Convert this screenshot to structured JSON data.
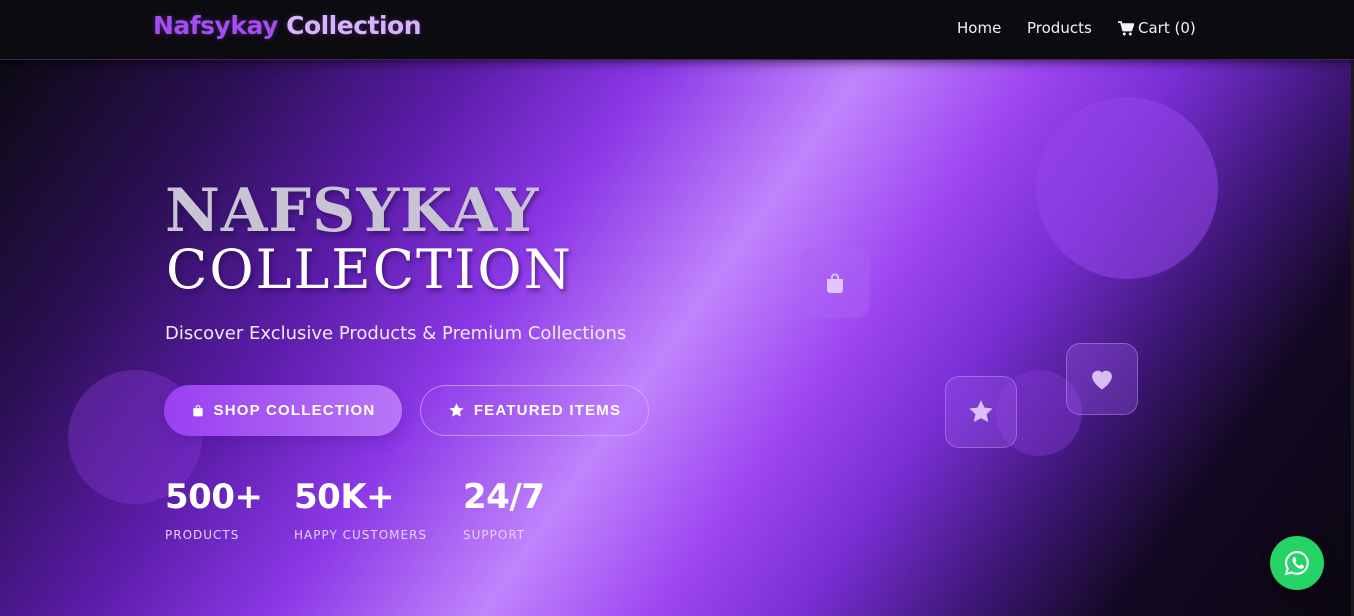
{
  "nav": {
    "brand_part1": "Nafsykay",
    "brand_part2": "Collection",
    "links": [
      {
        "label": "Home"
      },
      {
        "label": "Products"
      },
      {
        "label": "Cart (0)",
        "icon": "cart-icon"
      }
    ]
  },
  "hero": {
    "title_line1": "NAFSYKAY",
    "title_line2": "COLLECTION",
    "subtitle": "Discover Exclusive Products & Premium Collections",
    "buttons": [
      {
        "label": "SHOP COLLECTION",
        "icon": "shopping-bag-icon"
      },
      {
        "label": "FEATURED ITEMS",
        "icon": "star-icon"
      }
    ],
    "stats": [
      {
        "value": "500+",
        "label": "PRODUCTS"
      },
      {
        "value": "50K+",
        "label": "HAPPY CUSTOMERS"
      },
      {
        "value": "24/7",
        "label": "SUPPORT"
      }
    ],
    "floating_icons": [
      "shopping-bag-icon",
      "star-icon",
      "heart-icon"
    ]
  },
  "whatsapp": {
    "icon": "whatsapp-icon"
  },
  "colors": {
    "brand_primary": "#a54df3",
    "brand_secondary": "#d6b4fb",
    "navbar_bg": "#0c0b0f",
    "whatsapp_green": "#25d366",
    "hero_accent": "#c084fc"
  }
}
